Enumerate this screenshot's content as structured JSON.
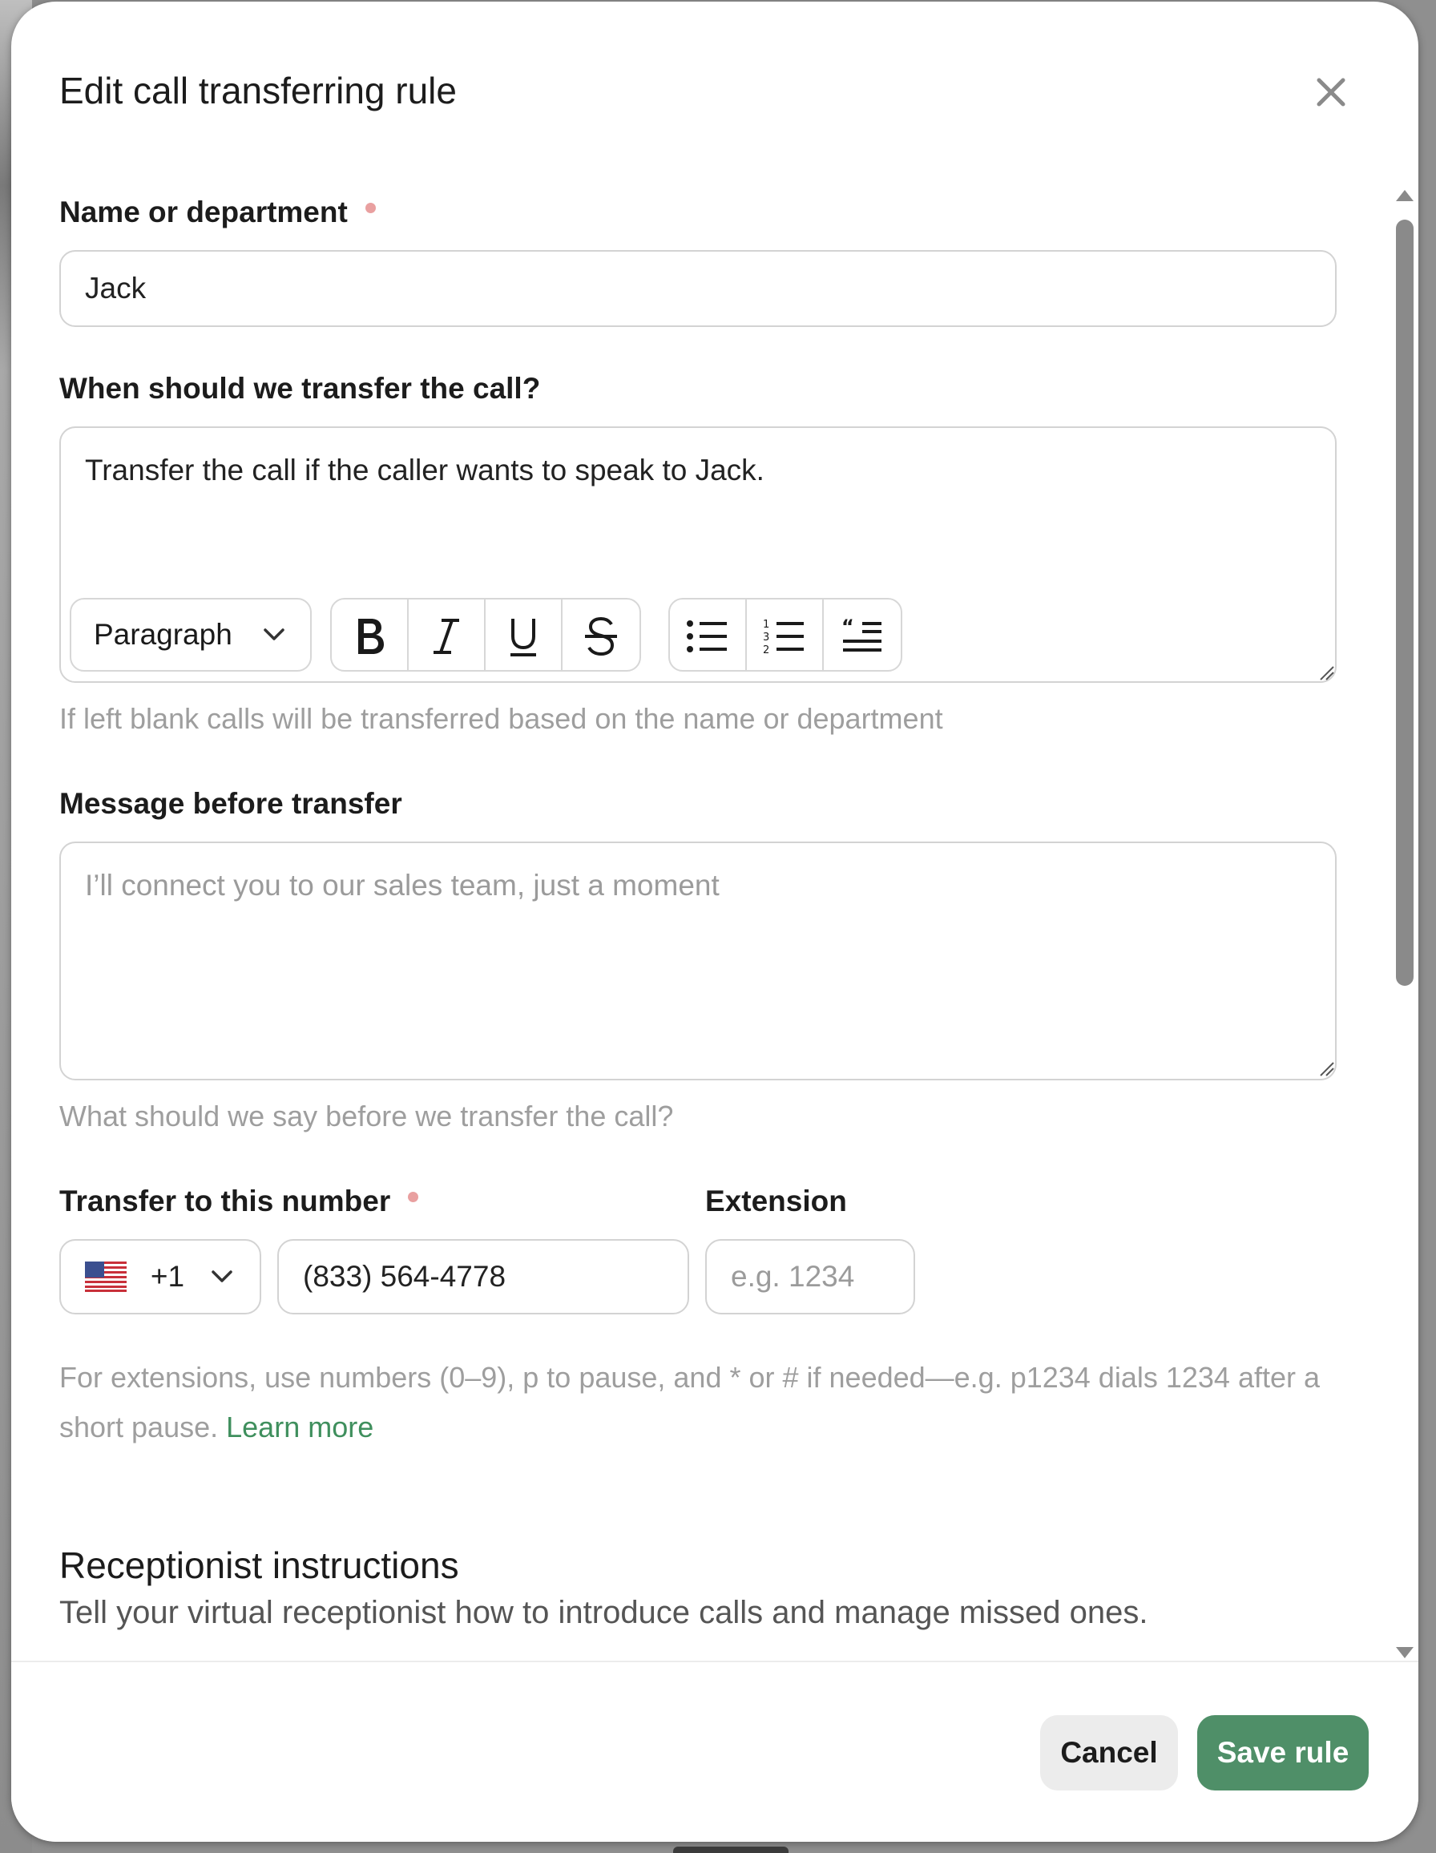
{
  "dialog": {
    "title": "Edit call transferring rule"
  },
  "name_field": {
    "label": "Name or department",
    "value": "Jack"
  },
  "when_field": {
    "label": "When should we transfer the call?",
    "value": "Transfer the call if the caller wants to speak to Jack.",
    "help": "If left blank calls will be transferred based on the name or department",
    "toolbar": {
      "block_style": "Paragraph"
    }
  },
  "message_field": {
    "label": "Message before transfer",
    "placeholder": "I’ll connect you to our sales team, just a moment",
    "help": "What should we say before we transfer the call?"
  },
  "number_field": {
    "label": "Transfer to this number",
    "country_code": "+1",
    "value": "(833) 564-4778"
  },
  "extension_field": {
    "label": "Extension",
    "placeholder": "e.g. 1234",
    "help_text": "For extensions, use numbers (0–9), p to pause, and * or # if needed—e.g. p1234 dials 1234 after a short pause.",
    "help_link": "Learn more"
  },
  "receptionist": {
    "title": "Receptionist instructions",
    "subtitle": "Tell your virtual receptionist how to introduce calls and manage missed ones."
  },
  "footer": {
    "cancel_label": "Cancel",
    "save_label": "Save rule"
  },
  "colors": {
    "accent": "#4f8f68",
    "link": "#3f8f5d",
    "required_dot": "#e9a0a0"
  }
}
